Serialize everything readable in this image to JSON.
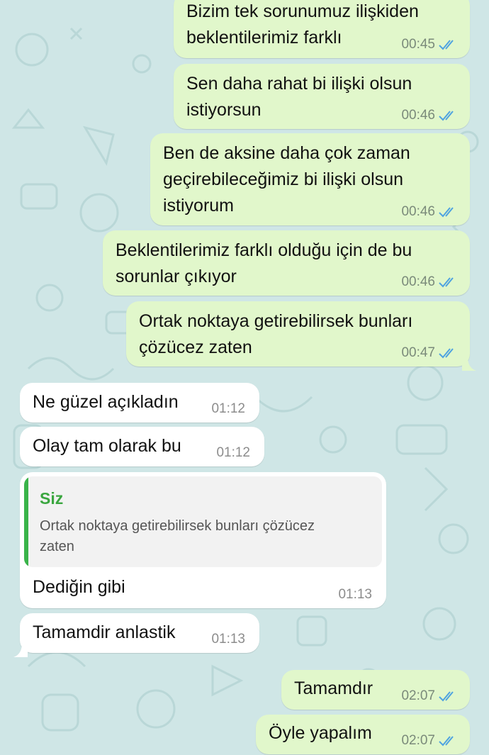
{
  "chat": {
    "messages": [
      {
        "dir": "out",
        "lines": [
          "Bizim tek sorunumuz ilişkiden",
          "beklentilerimiz farklı"
        ],
        "time": "00:45",
        "status": "read"
      },
      {
        "dir": "out",
        "lines": [
          "Sen daha rahat bi ilişki olsun",
          "istiyorsun"
        ],
        "time": "00:46",
        "status": "read"
      },
      {
        "dir": "out",
        "lines": [
          "Ben de aksine daha çok zaman",
          "geçirebileceğimiz bi ilişki olsun",
          "istiyorum"
        ],
        "time": "00:46",
        "status": "read"
      },
      {
        "dir": "out",
        "lines": [
          "Beklentilerimiz farklı olduğu için de bu",
          "sorunlar çıkıyor"
        ],
        "time": "00:46",
        "status": "read"
      },
      {
        "dir": "out",
        "lines": [
          "Ortak noktaya getirebilirsek bunları",
          "çözücez zaten"
        ],
        "time": "00:47",
        "status": "read"
      },
      {
        "dir": "in",
        "lines": [
          "Ne güzel açıkladın"
        ],
        "time": "01:12"
      },
      {
        "dir": "in",
        "lines": [
          "Olay tam olarak bu"
        ],
        "time": "01:12"
      },
      {
        "dir": "in",
        "reply": {
          "author": "Siz",
          "text": "Ortak noktaya getirebilirsek bunları çözücez zaten"
        },
        "lines": [
          "Dediğin gibi"
        ],
        "time": "01:13"
      },
      {
        "dir": "in",
        "lines": [
          "Tamamdir anlastik"
        ],
        "time": "01:13"
      },
      {
        "dir": "out",
        "lines": [
          "Tamamdır"
        ],
        "time": "02:07",
        "status": "read"
      },
      {
        "dir": "out",
        "lines": [
          "Öyle yapalım"
        ],
        "time": "02:07",
        "status": "read"
      }
    ]
  },
  "colors": {
    "outgoing_bubble": "#e1f7cb",
    "incoming_bubble": "#ffffff",
    "wallpaper": "#cfe6e6",
    "read_ticks": "#4fa3e0",
    "reply_author": "#3aa63f"
  },
  "icons": {
    "read_receipt": "double-check-icon"
  }
}
